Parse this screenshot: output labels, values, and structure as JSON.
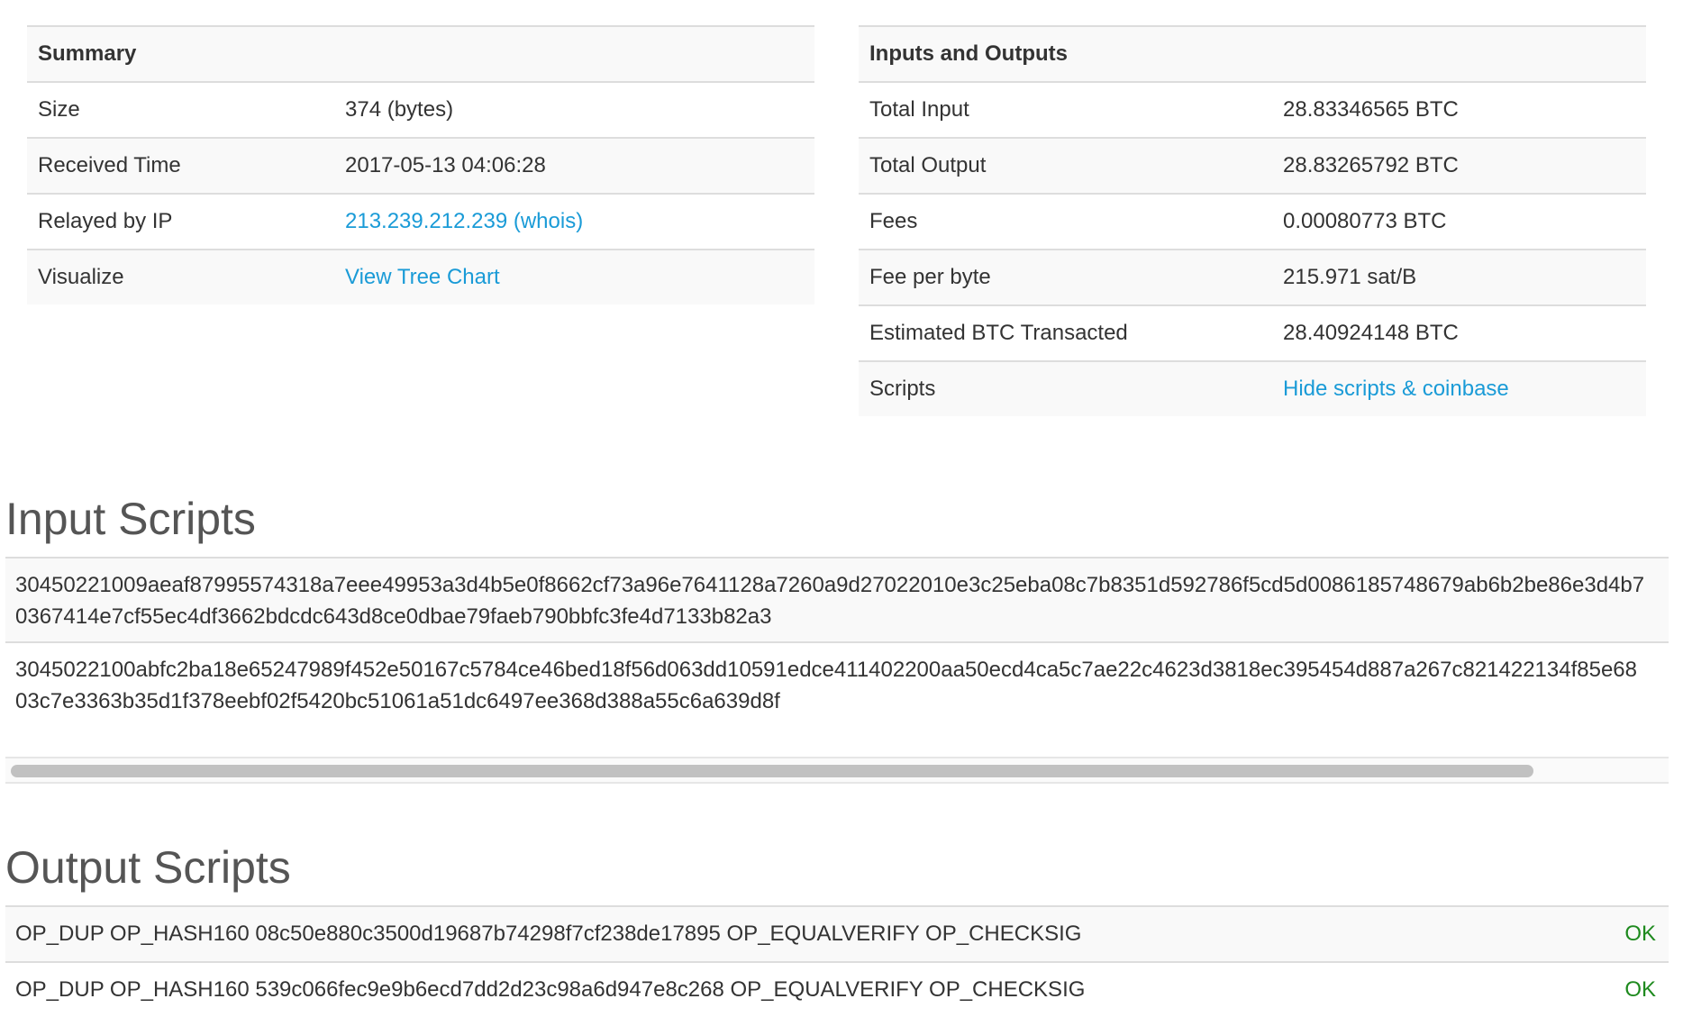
{
  "summary": {
    "header": "Summary",
    "rows": [
      {
        "label": "Size",
        "value": "374 (bytes)"
      },
      {
        "label": "Received Time",
        "value": "2017-05-13 04:06:28"
      },
      {
        "label": "Relayed by IP",
        "value": "213.239.212.239 (whois)"
      },
      {
        "label": "Visualize",
        "value": "View Tree Chart"
      }
    ]
  },
  "io": {
    "header": "Inputs and Outputs",
    "rows": [
      {
        "label": "Total Input",
        "value": "28.83346565 BTC"
      },
      {
        "label": "Total Output",
        "value": "28.83265792 BTC"
      },
      {
        "label": "Fees",
        "value": "0.00080773 BTC"
      },
      {
        "label": "Fee per byte",
        "value": "215.971 sat/B"
      },
      {
        "label": "Estimated BTC Transacted",
        "value": "28.40924148 BTC"
      },
      {
        "label": "Scripts",
        "value": "Hide scripts & coinbase"
      }
    ]
  },
  "input_scripts": {
    "title": "Input Scripts",
    "items": [
      {
        "line1": "30450221009aeaf87995574318a7eee49953a3d4b5e0f8662cf73a96e7641128a7260a9d27022010e3c25eba08c7b8351d592786f5cd5d0086185748679ab6b2be86e3d4b7",
        "line2": "0367414e7cf55ec4df3662bdcdc643d8ce0dbae79faeb790bbfc3fe4d7133b82a3"
      },
      {
        "line1": "3045022100abfc2ba18e65247989f452e50167c5784ce46bed18f56d063dd10591edce411402200aa50ecd4ca5c7ae22c4623d3818ec395454d887a267c821422134f85e68",
        "line2": "03c7e3363b35d1f378eebf02f5420bc51061a51dc6497ee368d388a55c6a639d8f"
      }
    ]
  },
  "output_scripts": {
    "title": "Output Scripts",
    "items": [
      {
        "script": "OP_DUP OP_HASH160 08c50e880c3500d19687b74298f7cf238de17895 OP_EQUALVERIFY OP_CHECKSIG",
        "status": "OK"
      },
      {
        "script": "OP_DUP OP_HASH160 539c066fec9e9b6ecd7dd2d23c98a6d947e8c268 OP_EQUALVERIFY OP_CHECKSIG",
        "status": "OK"
      }
    ]
  },
  "colors": {
    "link": "#1a9bd7",
    "ok": "#1e8a1e",
    "stripe": "#f9f9f9",
    "border": "#dddddd"
  }
}
